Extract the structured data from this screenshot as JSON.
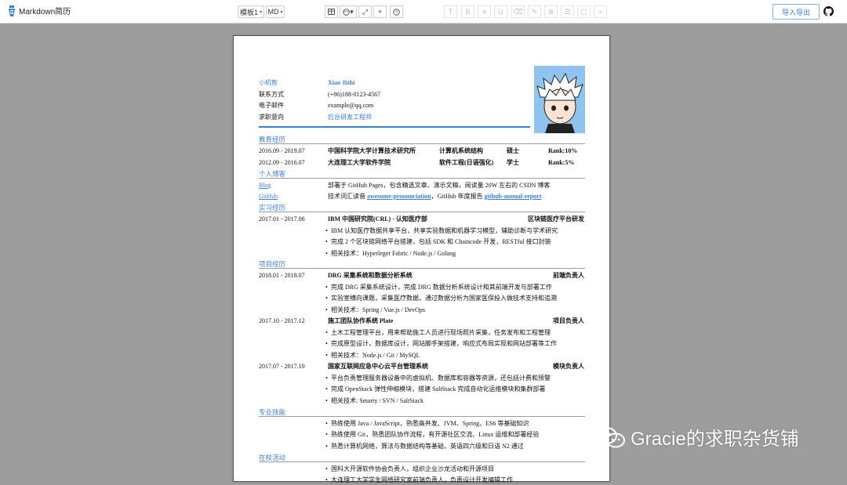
{
  "topbar": {
    "brand": "Markdown简历",
    "template_btn": "模板1",
    "md_btn": "MD",
    "tools": [
      "table-icon",
      "palette-icon",
      "expand-icon",
      "plus-icon",
      "help-icon"
    ],
    "format_tools": [
      "T",
      "B",
      "≡",
      "U",
      "⌫",
      "✎",
      "≣",
      "☰",
      "▢",
      "×"
    ],
    "export_label": "导入导出"
  },
  "resume": {
    "name_label": "小机智",
    "name_value": "Xiao Jizhi",
    "contact_label": "联系方式",
    "contact_value": "(+86)188-0123-4567",
    "email_label": "电子邮件",
    "email_value": "example@qq.com",
    "intent_label": "求职意向",
    "intent_value": "后台研发工程师",
    "education": {
      "title": "教育经历",
      "rows": [
        {
          "date": "2016.09 - 2019.07",
          "school": "中国科学院大学计算技术研究所",
          "major": "计算机系统结构",
          "degree": "硕士",
          "rank": "Rank:10%"
        },
        {
          "date": "2012.09 - 2016.07",
          "school": "大连理工大学软件学院",
          "major": "软件工程(日语强化)",
          "degree": "学士",
          "rank": "Rank:5%"
        }
      ]
    },
    "blog": {
      "title": "个人博客",
      "blog_label": "Blog",
      "blog_text": "部署于 GitHub Pages，包含精选文章、演示文稿，阅读量 20W 左右的 CSDN 博客",
      "github_label": "GitHub",
      "github_text1": "技术词汇读音",
      "github_link1": "awesome-pronunciation",
      "github_text2": "，GitHub 年度报告",
      "github_link2": "github-annual-report"
    },
    "internship": {
      "title": "实习经历",
      "date": "2017.01 - 2017.06",
      "org": "IBM 中国研究院(CRL) - 认知医疗部",
      "role": "区块链医疗平台研发",
      "bullets": [
        "IBM 认知医疗数据共享平台，共享实验数据和机器学习模型，辅助诊断与学术研究",
        "完成 2 个区块链网络平台搭建，包括 SDK 和 Chaincode 开发，RESTful 接口封装",
        "相关技术：Hyperleger Fabric / Node.js / Golang"
      ]
    },
    "projects": {
      "title": "项目经历",
      "items": [
        {
          "date": "2018.01 - 2018.07",
          "name": "DRG 采集系统和数据分析系统",
          "role": "前端负责人",
          "bullets": [
            "完成 DRG 采集系统设计，完成 DRG 数据分析系统设计和其前端开发与部署工作",
            "实验室横向课题，采集医疗数据，通过数据分析为国家医保投入做技术支持和追溯",
            "相关技术：Spring / Vue.js / DevOps"
          ]
        },
        {
          "date": "2017.10 - 2017.12",
          "name": "施工团队协作系统 Plate",
          "role": "项目负责人",
          "bullets": [
            "土木工程管理平台，用来帮助施工人员进行现场照片采集，任务发布和工程管理",
            "完成原型设计，数据库设计，网站脚手架搭建，响应式布局实现和网站部署等工作",
            "相关技术：Node.js / Git / MySQL"
          ]
        },
        {
          "date": "2017.07 - 2017.10",
          "name": "国家互联网应急中心云平台管理系统",
          "role": "模块负责人",
          "bullets": [
            "平台负责管理服务器设备中的虚拟机、数据库和容器等资源，还包括计费和预警",
            "完成 OpenStack 弹性伸缩模块，搭建 SaltStack 完成自动化运维模块和集群部署",
            "相关技术: Smarty / SVN / SaltStack"
          ]
        }
      ]
    },
    "skills": {
      "title": "专业技能",
      "bullets": [
        "熟练使用 Java / JavaScript，熟悉高并发、JVM、Spring、ES6 等基础知识",
        "熟练使用 Git，熟悉团队协作流程，有开源社区交流、Linux 运维和部署经验",
        "熟悉计算机网络，算法与数据结构等基础，英语四六级和日语 N2 通过"
      ]
    },
    "campus": {
      "title": "在校活动",
      "bullets": [
        "国科大开源软件协会负责人，组织企业沙龙活动和开源项目",
        "大连理工大学学生网络研究室前端负责人，负责设计开发编辑工作"
      ]
    }
  },
  "watermark": "Gracie的求职杂货铺"
}
